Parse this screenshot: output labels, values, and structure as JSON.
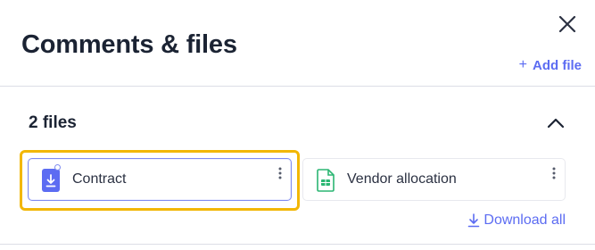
{
  "header": {
    "title": "Comments & files",
    "close_icon": "close-icon",
    "add_file": {
      "plus": "+",
      "label": "Add file"
    }
  },
  "files_section": {
    "count_label": "2 files",
    "collapse_icon": "chevron-up-icon",
    "files": [
      {
        "name": "Contract",
        "icon": "download-file-icon",
        "icon_color": "#5c6cf2",
        "selected": true
      },
      {
        "name": "Vendor allocation",
        "icon": "spreadsheet-file-icon",
        "icon_color": "#2bb673",
        "selected": false
      }
    ],
    "download_all": {
      "icon": "download-icon",
      "label": "Download all"
    }
  },
  "colors": {
    "accent": "#5c6cf2",
    "highlight": "#f2b705",
    "title": "#1b2333"
  }
}
